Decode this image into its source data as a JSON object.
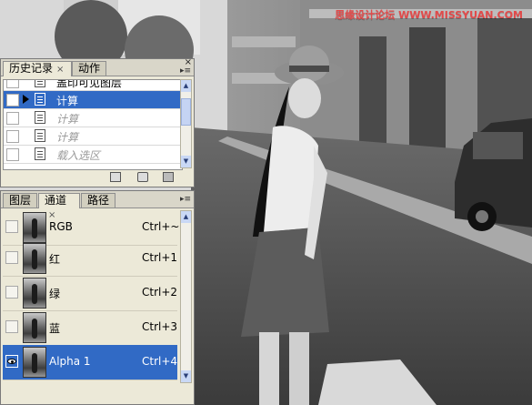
{
  "watermark": "思缘设计论坛 WWW.MISSYUAN.COM",
  "history_panel": {
    "tabs": [
      {
        "label": "历史记录",
        "close": "×"
      },
      {
        "label": "动作"
      }
    ],
    "close_glyph": "×",
    "menu_glyph": "▸≡",
    "items": [
      {
        "label": "盖印可见图层"
      },
      {
        "label": "计算"
      },
      {
        "label": "计算"
      },
      {
        "label": "计算"
      },
      {
        "label": "载入选区"
      }
    ],
    "selected_index": 1
  },
  "channels_panel": {
    "tabs": [
      {
        "label": "图层"
      },
      {
        "label": "通道",
        "close": "×"
      },
      {
        "label": "路径"
      }
    ],
    "menu_glyph": "▸≡",
    "channels": [
      {
        "name": "RGB",
        "shortcut": "Ctrl+~"
      },
      {
        "name": "红",
        "shortcut": "Ctrl+1"
      },
      {
        "name": "绿",
        "shortcut": "Ctrl+2"
      },
      {
        "name": "蓝",
        "shortcut": "Ctrl+3"
      },
      {
        "name": "Alpha 1",
        "shortcut": "Ctrl+4"
      }
    ],
    "selected_index": 4
  },
  "icons": [
    "new-snapshot-icon",
    "camera-icon",
    "trash-icon",
    "eye-icon",
    "document-icon"
  ],
  "colors": {
    "selection": "#316ac5",
    "panel": "#ece9d8"
  }
}
